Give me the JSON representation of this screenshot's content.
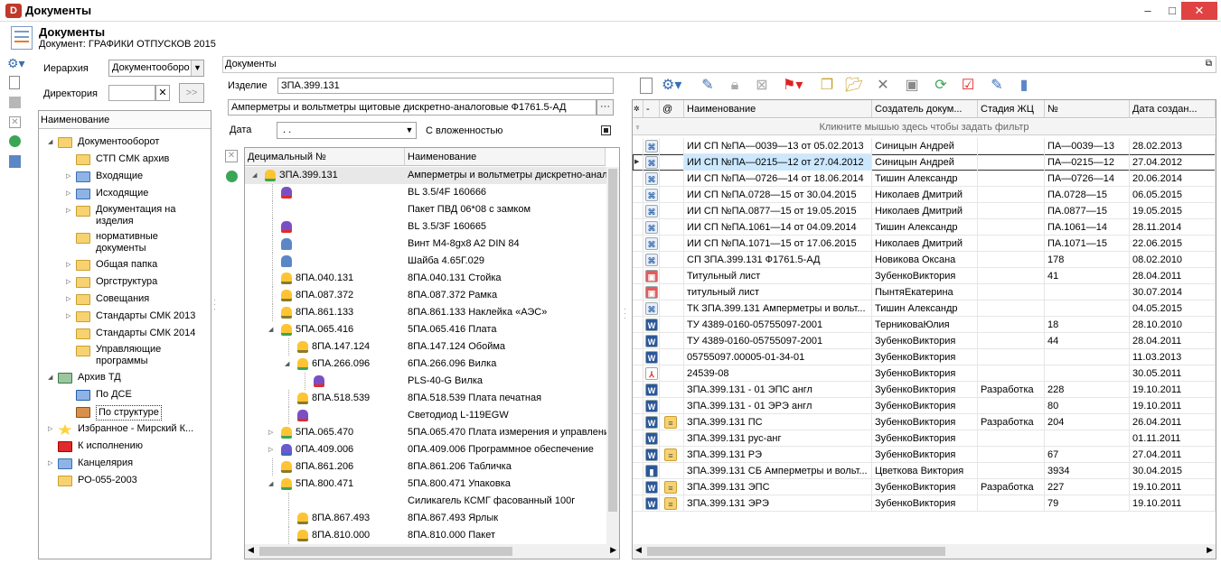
{
  "window": {
    "title": "Документы",
    "minimize": "–",
    "maximize": "□",
    "close": "✕"
  },
  "header": {
    "title": "Документы",
    "subtitle": "Документ: ГРАФИКИ ОТПУСКОВ 2015"
  },
  "left_panel": {
    "hierarchy_label": "Иерархия",
    "hierarchy_value": "Документооборо",
    "directory_label": "Директория",
    "directory_value": "",
    "clear": "✕",
    "go": ">>",
    "tree_header": "Наименование",
    "tree": [
      {
        "label": "Документооборот",
        "level": 0,
        "icon": "folder-open",
        "exp": "◢"
      },
      {
        "label": "СТП СМК архив",
        "level": 1,
        "icon": "folder",
        "exp": ""
      },
      {
        "label": "Входящие",
        "level": 1,
        "icon": "incoming",
        "exp": "▷"
      },
      {
        "label": "Исходящие",
        "level": 1,
        "icon": "outgoing",
        "exp": "▷"
      },
      {
        "label": "Документация на изделия",
        "level": 1,
        "icon": "folder",
        "exp": "▷",
        "two": true
      },
      {
        "label": "нормативные документы",
        "level": 1,
        "icon": "folder",
        "exp": "",
        "two": true
      },
      {
        "label": "Общая папка",
        "level": 1,
        "icon": "folder",
        "exp": "▷"
      },
      {
        "label": "Оргструктура",
        "level": 1,
        "icon": "folder",
        "exp": "▷"
      },
      {
        "label": "Совещания",
        "level": 1,
        "icon": "folder",
        "exp": "▷"
      },
      {
        "label": "Стандарты СМК 2013",
        "level": 1,
        "icon": "folder",
        "exp": "▷"
      },
      {
        "label": "Стандарты СМК 2014",
        "level": 1,
        "icon": "folder",
        "exp": ""
      },
      {
        "label": "Управляющие программы",
        "level": 1,
        "icon": "folder",
        "exp": "",
        "two": true
      },
      {
        "label": "Архив ТД",
        "level": 0,
        "icon": "archive",
        "exp": "◢"
      },
      {
        "label": "По ДСЕ",
        "level": 1,
        "icon": "table",
        "exp": ""
      },
      {
        "label": "По структуре",
        "level": 1,
        "icon": "box",
        "exp": "",
        "selected": true
      },
      {
        "label": "Избранное - Мирский К...",
        "level": 0,
        "icon": "star",
        "exp": "▷"
      },
      {
        "label": "К исполнению",
        "level": 0,
        "icon": "flag",
        "exp": ""
      },
      {
        "label": "Канцелярия",
        "level": 0,
        "icon": "edit",
        "exp": "▷"
      },
      {
        "label": "РО-055-2003",
        "level": 0,
        "icon": "folder",
        "exp": ""
      }
    ]
  },
  "middle_panel": {
    "caption": "Документы",
    "item_label": "Изделие",
    "item_value": "ЗПА.399.131",
    "item_name": "Амперметры и вольтметры щитовые дискретно-аналоговые Ф1761.5-АД",
    "dots": "···",
    "date_label": "Дата",
    "date_value": " .  .",
    "nested_label": "С вложенностью",
    "col_decimal": "Децимальный №",
    "col_name": "Наименование",
    "rows": [
      {
        "dec": "ЗПА.399.131",
        "name": "Амперметры и вольтметры дискретно-аналоговые",
        "level": 0,
        "icon": "asm",
        "exp": "◢",
        "sel": true
      },
      {
        "dec": "",
        "name": "BL 3.5/4F 160666",
        "level": 1,
        "icon": "part"
      },
      {
        "dec": "",
        "name": "Пакет ПВД 06*08 с замком",
        "level": 1,
        "icon": ""
      },
      {
        "dec": "",
        "name": "BL 3.5/3F 160665",
        "level": 1,
        "icon": "part"
      },
      {
        "dec": "",
        "name": "Винт M4-8gx8 A2 DIN 84",
        "level": 1,
        "icon": "screw"
      },
      {
        "dec": "",
        "name": "Шайба 4.65Г.029",
        "level": 1,
        "icon": "screw"
      },
      {
        "dec": "8ПА.040.131",
        "name": "8ПА.040.131 Стойка",
        "level": 1,
        "icon": "det"
      },
      {
        "dec": "8ПА.087.372",
        "name": "8ПА.087.372 Рамка",
        "level": 1,
        "icon": "det"
      },
      {
        "dec": "8ПА.861.133",
        "name": "8ПА.861.133 Наклейка «АЭС»",
        "level": 1,
        "icon": "det"
      },
      {
        "dec": "5ПА.065.416",
        "name": "5ПА.065.416 Плата",
        "level": 1,
        "icon": "asm",
        "exp": "◢"
      },
      {
        "dec": "8ПА.147.124",
        "name": "8ПА.147.124 Обойма",
        "level": 2,
        "icon": "det"
      },
      {
        "dec": "6ПА.266.096",
        "name": "6ПА.266.096  Вилка",
        "level": 2,
        "icon": "asm",
        "exp": "◢"
      },
      {
        "dec": "",
        "name": "PLS-40-G Вилка",
        "level": 3,
        "icon": "part"
      },
      {
        "dec": "8ПА.518.539",
        "name": "8ПА.518.539 Плата печатная",
        "level": 2,
        "icon": "det"
      },
      {
        "dec": "",
        "name": "Светодиод L-119EGW",
        "level": 2,
        "icon": "part"
      },
      {
        "dec": "5ПА.065.470",
        "name": "5ПА.065.470 Плата измерения и управлени",
        "level": 1,
        "icon": "asm",
        "exp": "▷"
      },
      {
        "dec": "0ПА.409.006",
        "name": "0ПА.409.006 Программное обеспечение",
        "level": 1,
        "icon": "soft",
        "exp": "▷"
      },
      {
        "dec": "8ПА.861.206",
        "name": "8ПА.861.206 Табличка",
        "level": 1,
        "icon": "det"
      },
      {
        "dec": "5ПА.800.471",
        "name": "5ПА.800.471 Упаковка",
        "level": 1,
        "icon": "asm",
        "exp": "◢"
      },
      {
        "dec": "",
        "name": "Силикагель КСМГ фасованный 100г",
        "level": 2,
        "icon": ""
      },
      {
        "dec": "8ПА.867.493",
        "name": "8ПА.867.493 Ярлык",
        "level": 2,
        "icon": "det"
      },
      {
        "dec": "8ПА.810.000",
        "name": "8ПА.810.000 Пакет",
        "level": 2,
        "icon": "det"
      }
    ]
  },
  "right_panel": {
    "filter_hint": "Кликните мышью здесь чтобы задать фильтр",
    "col_name": "Наименование",
    "col_creator": "Создатель докум...",
    "col_stage": "Стадия ЖЦ",
    "col_no": "№",
    "col_date": "Дата создан...",
    "col_at": "@",
    "col_dash": "-",
    "rows": [
      {
        "i": "link",
        "n": "ИИ СП №ПА—0039—13 от 05.02.2013",
        "c": "Синицын Андрей",
        "s": "",
        "no": "ПА—0039—13",
        "d": "28.02.2013"
      },
      {
        "i": "link",
        "n": "ИИ СП №ПА—0215—12 от 27.04.2012",
        "c": "Синицын Андрей",
        "s": "",
        "no": "ПА—0215—12",
        "d": "27.04.2012",
        "sel": true
      },
      {
        "i": "link",
        "n": "ИИ СП №ПА—0726—14 от 18.06.2014",
        "c": "Тишин Александр",
        "s": "",
        "no": "ПА—0726—14",
        "d": "20.06.2014"
      },
      {
        "i": "link",
        "n": "ИИ СП №ПА.0728—15 от 30.04.2015",
        "c": "Николаев Дмитрий",
        "s": "",
        "no": "ПА.0728—15",
        "d": "06.05.2015"
      },
      {
        "i": "link",
        "n": "ИИ СП №ПА.0877—15 от 19.05.2015",
        "c": "Николаев Дмитрий",
        "s": "",
        "no": "ПА.0877—15",
        "d": "19.05.2015"
      },
      {
        "i": "link",
        "n": "ИИ СП №ПА.1061—14 от 04.09.2014",
        "c": "Тишин Александр",
        "s": "",
        "no": "ПА.1061—14",
        "d": "28.11.2014"
      },
      {
        "i": "link",
        "n": "ИИ СП №ПА.1071—15 от 17.06.2015",
        "c": "Николаев Дмитрий",
        "s": "",
        "no": "ПА.1071—15",
        "d": "22.06.2015"
      },
      {
        "i": "link",
        "n": "СП ЗПА.399.131 Ф1761.5-АД",
        "c": "Новикова Оксана",
        "s": "",
        "no": "178",
        "d": "08.02.2010"
      },
      {
        "i": "img",
        "n": "Титульный лист",
        "c": "ЗубенкоВиктория",
        "s": "",
        "no": "41",
        "d": "28.04.2011"
      },
      {
        "i": "img",
        "n": "титульный лист",
        "c": "ПынтяЕкатерина",
        "s": "",
        "no": "",
        "d": "30.07.2014"
      },
      {
        "i": "link",
        "n": "ТК ЗПА.399.131   Амперметры и вольт...",
        "c": "Тишин Александр",
        "s": "",
        "no": "",
        "d": "04.05.2015"
      },
      {
        "i": "word",
        "n": "ТУ  4389-0160-05755097-2001",
        "c": "ТерниковаЮлия",
        "s": "",
        "no": "18",
        "d": "28.10.2010"
      },
      {
        "i": "word",
        "n": "ТУ 4389-0160-05755097-2001",
        "c": "ЗубенкоВиктория",
        "s": "",
        "no": "44",
        "d": "28.04.2011"
      },
      {
        "i": "word",
        "n": "05755097.00005-01-34-01",
        "c": "ЗубенкоВиктория",
        "s": "",
        "no": "",
        "d": "11.03.2013"
      },
      {
        "i": "pdf",
        "n": "24539-08",
        "c": "ЗубенкоВиктория",
        "s": "",
        "no": "",
        "d": "30.05.2011"
      },
      {
        "i": "word",
        "n": "ЗПА.399.131 - 01 ЭПС англ",
        "c": "ЗубенкоВиктория",
        "s": "Разработка",
        "no": "228",
        "d": "19.10.2011"
      },
      {
        "i": "word",
        "n": "ЗПА.399.131 - 01 ЭРЭ англ",
        "c": "ЗубенкоВиктория",
        "s": "",
        "no": "80",
        "d": "19.10.2011"
      },
      {
        "i": "word",
        "n": "ЗПА.399.131 ПС",
        "c": "ЗубенкоВиктория",
        "s": "Разработка",
        "no": "204",
        "d": "26.04.2011",
        "at": true
      },
      {
        "i": "word",
        "n": "ЗПА.399.131 рус-анг",
        "c": "ЗубенкоВиктория",
        "s": "",
        "no": "",
        "d": "01.11.2011"
      },
      {
        "i": "word",
        "n": "ЗПА.399.131 РЭ",
        "c": "ЗубенкоВиктория",
        "s": "",
        "no": "67",
        "d": "27.04.2011",
        "at": true
      },
      {
        "i": "book",
        "n": "ЗПА.399.131 СБ Амперметры и вольт...",
        "c": "Цветкова Виктория",
        "s": "",
        "no": "3934",
        "d": "30.04.2015"
      },
      {
        "i": "word",
        "n": "ЗПА.399.131 ЭПС",
        "c": "ЗубенкоВиктория",
        "s": "Разработка",
        "no": "227",
        "d": "19.10.2011",
        "at": true
      },
      {
        "i": "word",
        "n": "ЗПА.399.131 ЭРЭ",
        "c": "ЗубенкоВиктория",
        "s": "",
        "no": "79",
        "d": "19.10.2011",
        "at": true
      }
    ]
  },
  "colors": {
    "selection": "#cce8ff",
    "accent": "#3399ff",
    "folder": "#f6d271"
  }
}
